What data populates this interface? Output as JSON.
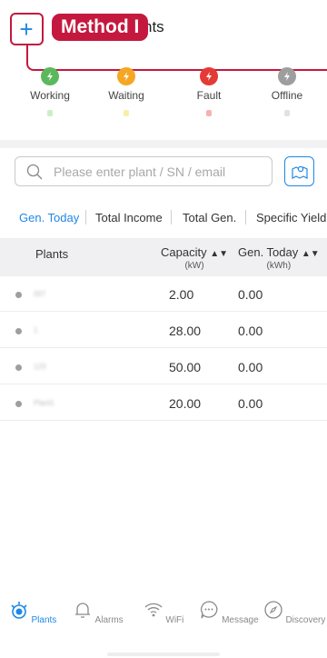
{
  "header": {
    "title_visible": "nts",
    "add_label": "+",
    "annotation": "Method I"
  },
  "status": [
    {
      "label": "Working",
      "color": "#5cb85c",
      "count_color": "#c8f0c8"
    },
    {
      "label": "Waiting",
      "color": "#f5a623",
      "count_color": "#f7efa8"
    },
    {
      "label": "Fault",
      "color": "#e53935",
      "count_color": "#f4b2b2"
    },
    {
      "label": "Offline",
      "color": "#9e9e9e",
      "count_color": "#e2e2e2"
    }
  ],
  "search": {
    "placeholder": "Please enter plant / SN / email"
  },
  "tabs": [
    "Gen. Today",
    "Total Income",
    "Total Gen.",
    "Specific Yield"
  ],
  "table": {
    "columns": [
      {
        "label": "Plants",
        "unit": ""
      },
      {
        "label": "Capacity",
        "unit": "(kW)"
      },
      {
        "label": "Gen. Today",
        "unit": "(kWh)"
      }
    ],
    "rows": [
      {
        "name": "007",
        "capacity": "2.00",
        "gen_today": "0.00"
      },
      {
        "name": "1",
        "capacity": "28.00",
        "gen_today": "0.00"
      },
      {
        "name": "123",
        "capacity": "50.00",
        "gen_today": "0.00"
      },
      {
        "name": "Plant1",
        "capacity": "20.00",
        "gen_today": "0.00"
      }
    ]
  },
  "nav": [
    {
      "label": "Plants",
      "icon": "plants-icon",
      "active": true
    },
    {
      "label": "Alarms",
      "icon": "bell-icon",
      "active": false
    },
    {
      "label": "WiFi",
      "icon": "wifi-icon",
      "active": false
    },
    {
      "label": "Message",
      "icon": "message-icon",
      "active": false
    },
    {
      "label": "Discovery",
      "icon": "compass-icon",
      "active": false
    }
  ],
  "colors": {
    "accent": "#1e88e5",
    "annotation": "#c5183f"
  }
}
